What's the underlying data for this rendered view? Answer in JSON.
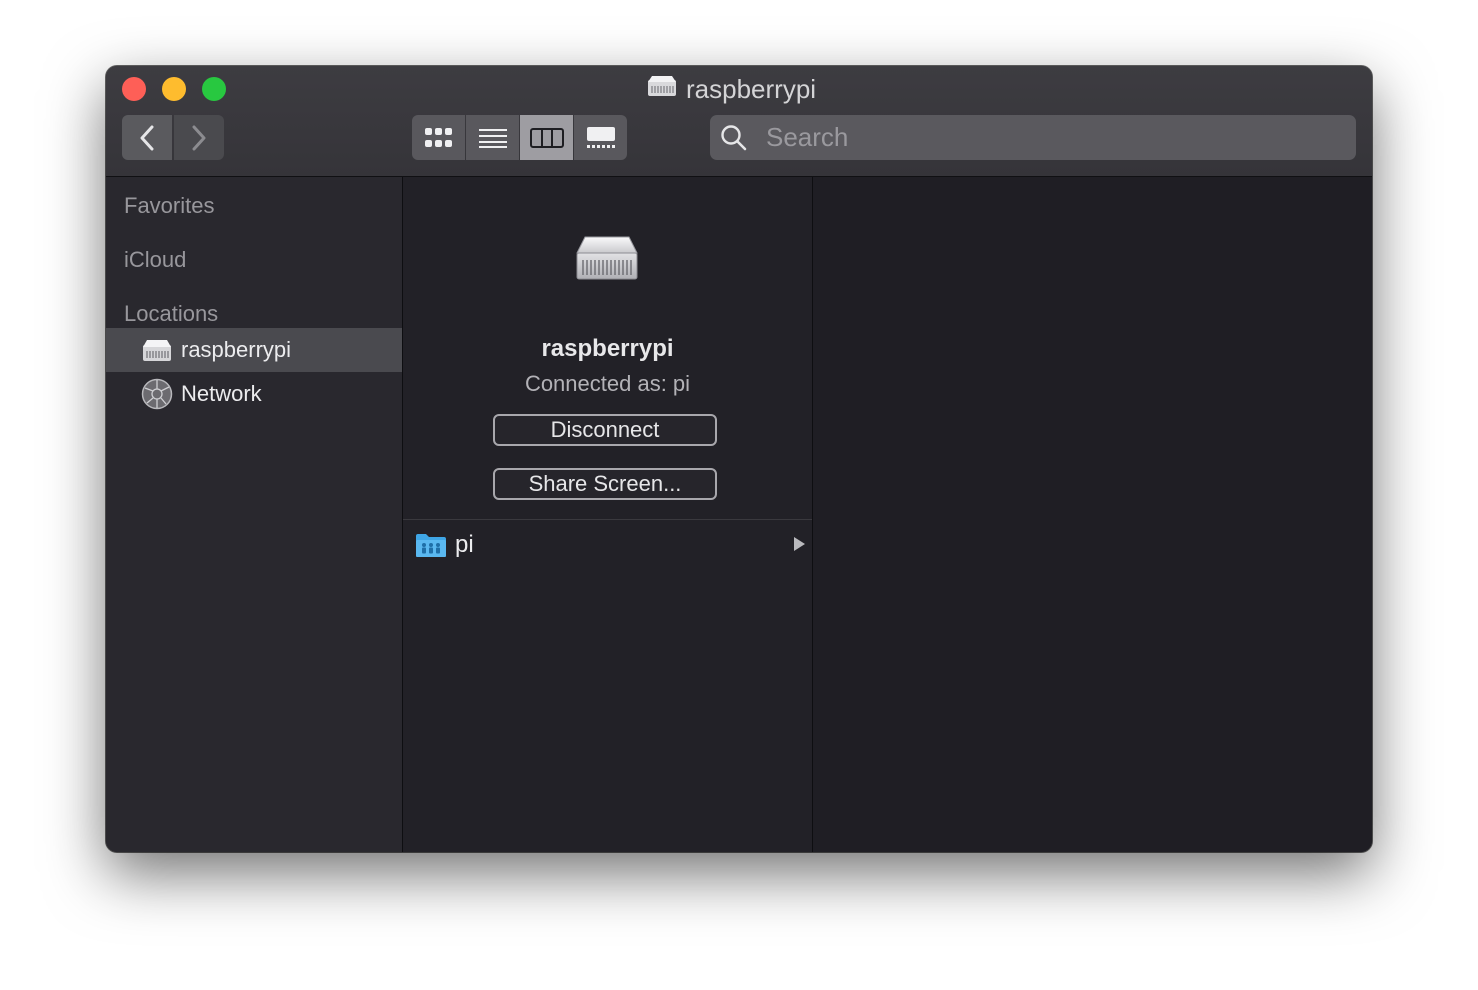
{
  "window": {
    "title": "raspberrypi"
  },
  "toolbar": {
    "back_icon": "chevron-left-icon",
    "forward_icon": "chevron-right-icon",
    "views": [
      "icon-view",
      "list-view",
      "column-view",
      "gallery-view"
    ],
    "active_view": "column-view",
    "search_placeholder": "Search"
  },
  "sidebar": {
    "sections": {
      "favorites": "Favorites",
      "icloud": "iCloud",
      "locations": "Locations"
    },
    "items": [
      {
        "label": "raspberrypi",
        "icon": "server-icon",
        "selected": true
      },
      {
        "label": "Network",
        "icon": "network-globe-icon",
        "selected": false
      }
    ]
  },
  "preview": {
    "name": "raspberrypi",
    "status": "Connected as: pi",
    "disconnect_label": "Disconnect",
    "share_screen_label": "Share Screen..."
  },
  "column": {
    "items": [
      {
        "label": "pi",
        "icon": "shared-folder-icon"
      }
    ]
  },
  "colors": {
    "close": "#fe5f57",
    "minimize": "#febc2e",
    "maximize": "#28c840",
    "selection": "#4a4a4f"
  }
}
